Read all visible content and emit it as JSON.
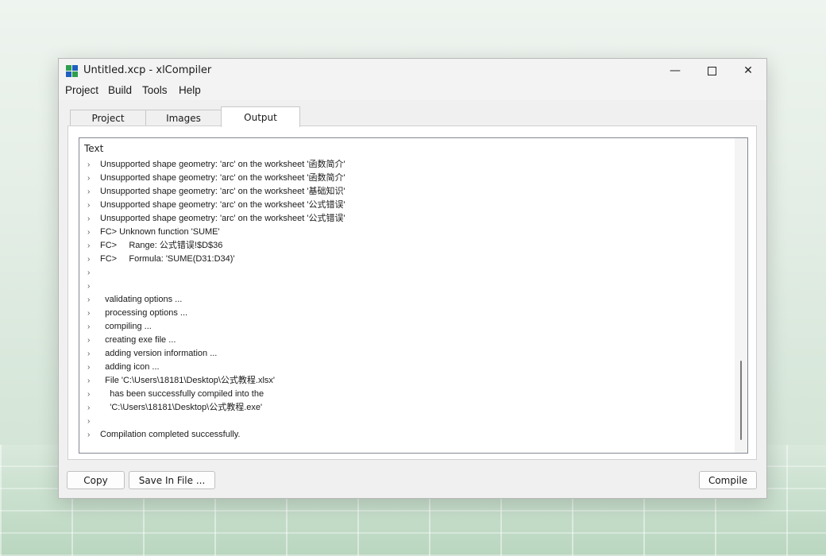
{
  "window": {
    "title": "Untitled.xcp - xlCompiler"
  },
  "menu": [
    "Project",
    "Build",
    "Tools",
    "Help"
  ],
  "tabs": [
    {
      "label": "Project",
      "active": false
    },
    {
      "label": "Images",
      "active": false
    },
    {
      "label": "Output",
      "active": true
    }
  ],
  "output": {
    "column_header": "Text",
    "lines": [
      "Unsupported shape geometry: 'arc' on the worksheet '函数简介'",
      "Unsupported shape geometry: 'arc' on the worksheet '函数简介'",
      "Unsupported shape geometry: 'arc' on the worksheet '基础知识'",
      "Unsupported shape geometry: 'arc' on the worksheet '公式错误'",
      "Unsupported shape geometry: 'arc' on the worksheet '公式错误'",
      "FC> Unknown function 'SUME'",
      "FC>     Range: 公式错误!$D$36",
      "FC>     Formula: 'SUME(D31:D34)'",
      "",
      "",
      "  validating options ...",
      "  processing options ...",
      "  compiling ...",
      "  creating exe file ...",
      "  adding version information ...",
      "  adding icon ...",
      "  File 'C:\\Users\\18181\\Desktop\\公式教程.xlsx'",
      "    has been successfully compiled into the",
      "    'C:\\Users\\18181\\Desktop\\公式教程.exe'",
      "",
      "Compilation completed successfully."
    ]
  },
  "buttons": {
    "copy": "Copy",
    "save": "Save In File ...",
    "compile": "Compile"
  },
  "icons": {
    "minimize": "minimize-icon",
    "maximize": "maximize-icon",
    "close": "close-icon",
    "row": "chevron-right-icon"
  },
  "colors": {
    "icon_blue": "#1f5fbf",
    "icon_green": "#2e9e4f"
  }
}
